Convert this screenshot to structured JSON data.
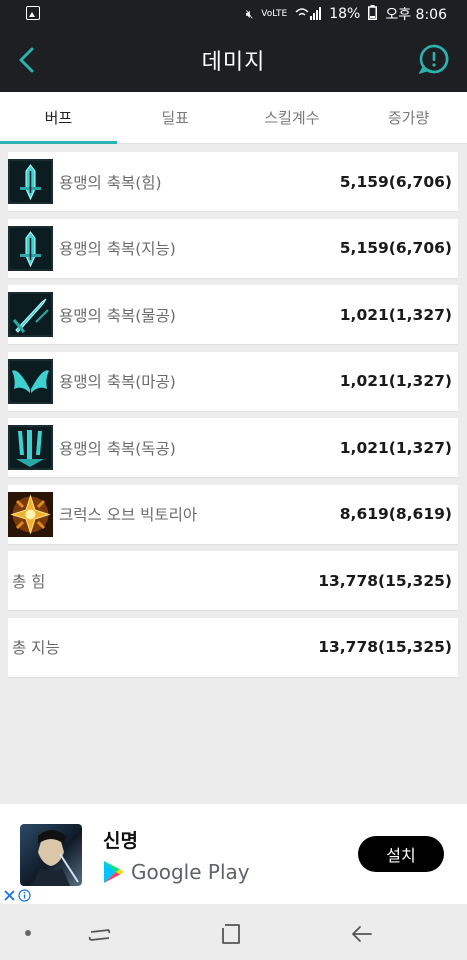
{
  "status_bar": {
    "battery": "18%",
    "time": "오후 8:06",
    "network_label": "VoLTE"
  },
  "header": {
    "title": "데미지"
  },
  "tabs": [
    {
      "label": "버프",
      "active": true
    },
    {
      "label": "딜표",
      "active": false
    },
    {
      "label": "스킬계수",
      "active": false
    },
    {
      "label": "증가량",
      "active": false
    }
  ],
  "buffs": [
    {
      "name": "용맹의 축복(힘)",
      "value": "5,159(6,706)",
      "icon": "sword-down-icon"
    },
    {
      "name": "용맹의 축복(지능)",
      "value": "5,159(6,706)",
      "icon": "sword-down-icon"
    },
    {
      "name": "용맹의 축복(물공)",
      "value": "1,021(1,327)",
      "icon": "sword-slash-icon"
    },
    {
      "name": "용맹의 축복(마공)",
      "value": "1,021(1,327)",
      "icon": "wings-icon"
    },
    {
      "name": "용맹의 축복(독공)",
      "value": "1,021(1,327)",
      "icon": "claw-icon"
    },
    {
      "name": "크럭스 오브 빅토리아",
      "value": "8,619(8,619)",
      "icon": "golden-cross-icon"
    }
  ],
  "totals": [
    {
      "name": "총 힘",
      "value": "13,778(15,325)"
    },
    {
      "name": "총 지능",
      "value": "13,778(15,325)"
    }
  ],
  "ad": {
    "app_name": "신명",
    "store": "Google Play",
    "install_label": "설치"
  },
  "colors": {
    "accent": "#2bb3b1",
    "header_bg": "#1e1f23",
    "page_bg": "#ececec"
  }
}
